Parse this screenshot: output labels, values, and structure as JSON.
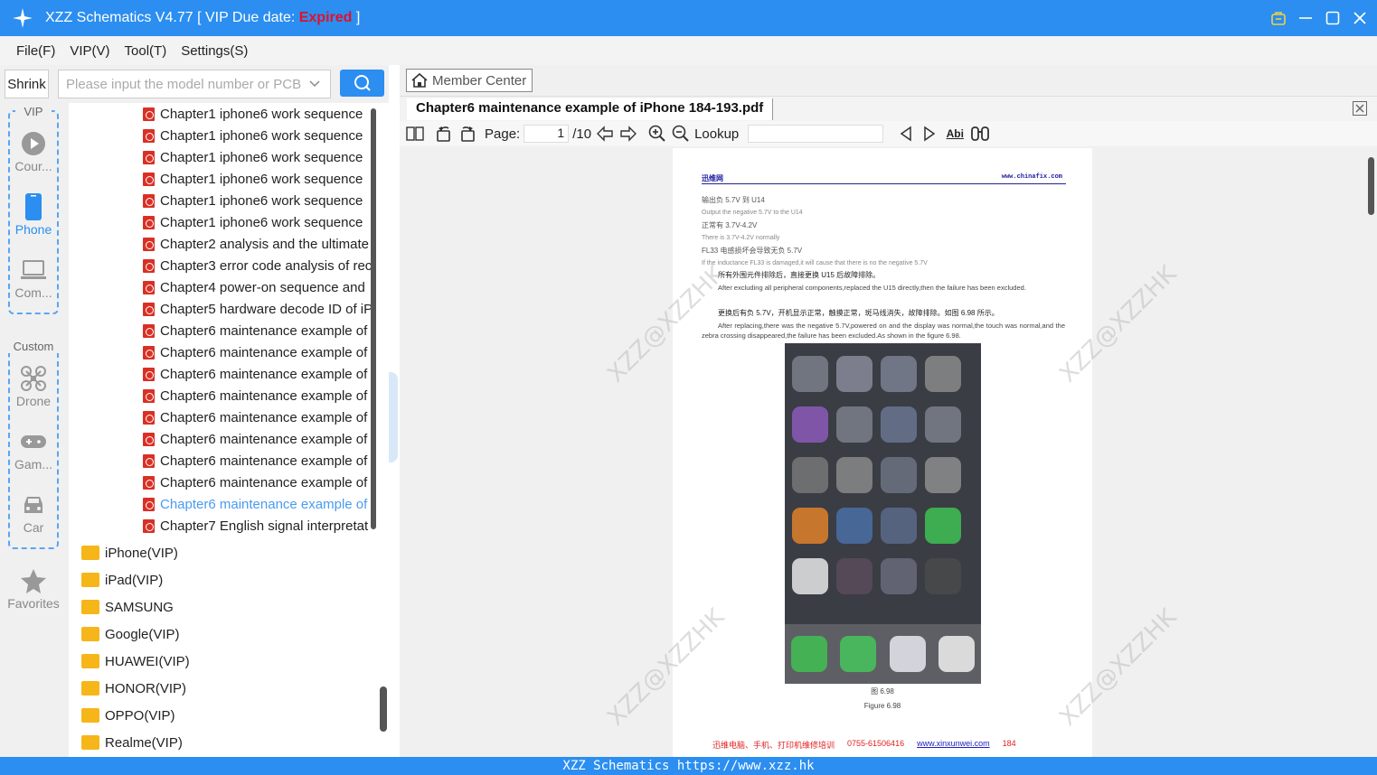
{
  "titlebar": {
    "app_name": "XZZ Schematics V4.77 [ VIP Due date: ",
    "status": "Expired",
    "suffix": " ]"
  },
  "menu": [
    "File(F)",
    "VIP(V)",
    "Tool(T)",
    "Settings(S)"
  ],
  "search": {
    "shrink_label": "Shrink",
    "placeholder": "Please input the model number or PCB"
  },
  "sidebar": {
    "vip_group_title": "VIP",
    "vip_items": [
      {
        "label": "Cour...",
        "icon": "play-circle-icon"
      },
      {
        "label": "Phone",
        "icon": "phone-icon",
        "active": true
      },
      {
        "label": "Com...",
        "icon": "laptop-icon"
      }
    ],
    "custom_group_title": "Custom",
    "custom_items": [
      {
        "label": "Drone",
        "icon": "drone-icon"
      },
      {
        "label": "Gam...",
        "icon": "gamepad-icon"
      },
      {
        "label": "Car",
        "icon": "car-icon"
      }
    ],
    "favorites_label": "Favorites"
  },
  "tree": {
    "files": [
      "Chapter1 iphone6 work sequence",
      "Chapter1 iphone6 work sequence",
      "Chapter1 iphone6 work sequence",
      "Chapter1 iphone6 work sequence",
      "Chapter1 iphone6 work sequence",
      "Chapter1 iphone6 work sequence",
      "Chapter2 analysis and the ultimate",
      "Chapter3 error code analysis of rec",
      "Chapter4 power-on sequence and",
      "Chapter5 hardware decode ID of iP",
      "Chapter6 maintenance example of",
      "Chapter6 maintenance example of",
      "Chapter6 maintenance example of",
      "Chapter6 maintenance example of",
      "Chapter6 maintenance example of",
      "Chapter6 maintenance example of",
      "Chapter6 maintenance example of",
      "Chapter6 maintenance example of",
      "Chapter6 maintenance example of",
      "Chapter7 English signal interpretat"
    ],
    "highlighted_index": 18,
    "folders": [
      "iPhone(VIP)",
      "iPad(VIP)",
      "SAMSUNG",
      "Google(VIP)",
      "HUAWEI(VIP)",
      "HONOR(VIP)",
      "OPPO(VIP)",
      "Realme(VIP)"
    ]
  },
  "right": {
    "member_center": "Member Center",
    "tab_title": "Chapter6 maintenance example of iPhone 184-193.pdf",
    "page_label": "Page:",
    "page_current": "1",
    "page_total": "/10",
    "lookup_label": "Lookup",
    "abi_label": "Abi"
  },
  "document": {
    "header_left": "迅维网",
    "header_right": "www.chinafix.com",
    "lines": [
      "输出负 5.7V 到 U14",
      "Output the negative 5.7V to the U14",
      "正常有 3.7V-4.2V",
      "There is 3.7V-4.2V normally",
      "FL33 电感损坏会导致无负 5.7V",
      "If the inductance FL33 is damaged,it will cause that there is no the negative 5.7V",
      "所有外围元件排除后，直接更换 U15 后故障排除。",
      "After excluding all peripheral components,replaced the U15 directly,then the failure has been excluded.",
      "更换后有负 5.7V，开机显示正常，触摸正常，斑马线消失，故障排除。如图 6.98 所示。",
      "After replacing,there was the negative 5.7V,powered on and the display was normal,the touch was normal,and the zebra crossing disappeared,the failure has been excluded.As shown in the figure 6.98."
    ],
    "caption_cn": "图 6.98",
    "caption_en": "Figure 6.98",
    "footer_text": "迅维电脑、手机、打印机维修培训",
    "footer_phone": "0755-61506416",
    "footer_url": "www.xinxunwei.com",
    "footer_page": "184",
    "watermark": "XZZ@XZZHK"
  },
  "statusbar": "XZZ Schematics https://www.xzz.hk"
}
